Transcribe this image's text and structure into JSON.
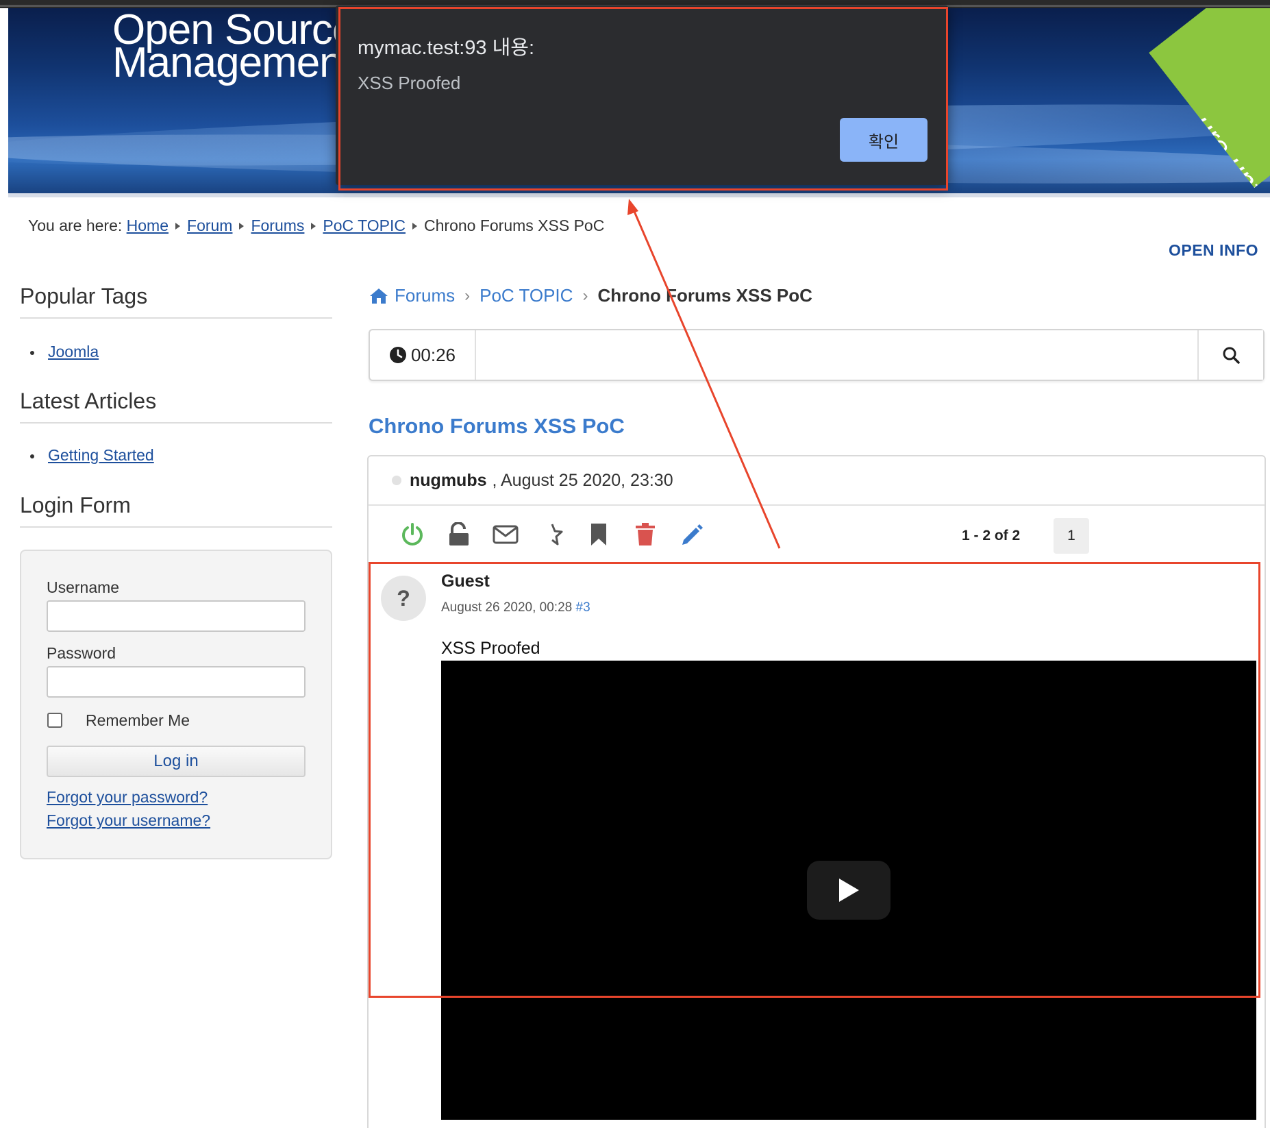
{
  "site": {
    "title": "Open Source\nManagement",
    "ribbon": "ure\nunteers!"
  },
  "alert": {
    "title": "mymac.test:93 내용:",
    "message": "XSS Proofed",
    "ok": "확인"
  },
  "breadcrumb": {
    "prefix": "You are here:",
    "items": [
      "Home",
      "Forum",
      "Forums",
      "PoC TOPIC"
    ],
    "current": "Chrono Forums XSS PoC"
  },
  "open_info": "OPEN INFO",
  "sidebar": {
    "popular_tags": {
      "heading": "Popular Tags",
      "items": [
        "Joomla"
      ]
    },
    "latest_articles": {
      "heading": "Latest Articles",
      "items": [
        "Getting Started"
      ]
    },
    "login": {
      "heading": "Login Form",
      "username_label": "Username",
      "password_label": "Password",
      "remember": "Remember Me",
      "button": "Log in",
      "forgot_password": "Forgot your password?",
      "forgot_username": "Forgot your username?"
    }
  },
  "forum": {
    "crumbs": [
      "Forums",
      "PoC TOPIC"
    ],
    "current": "Chrono Forums XSS PoC",
    "timer": "00:26",
    "topic_title": "Chrono Forums XSS PoC",
    "topic_author": "nugmubs",
    "topic_date": ", August 25 2020, 23:30",
    "pagination": {
      "count": "1 - 2 of 2",
      "page": "1"
    },
    "post": {
      "avatar": "?",
      "author": "Guest",
      "date": "August 26 2020, 00:28",
      "anchor": "#3",
      "body": "XSS Proofed"
    }
  },
  "colors": {
    "accent": "#3b7bcc",
    "annotation": "#e8452c",
    "alert_button": "#8ab4f8"
  },
  "icons": [
    "power-icon",
    "unlock-icon",
    "envelope-icon",
    "star-half-icon",
    "bookmark-icon",
    "trash-icon",
    "pencil-icon",
    "search-icon",
    "clock-icon",
    "home-icon",
    "play-icon"
  ]
}
